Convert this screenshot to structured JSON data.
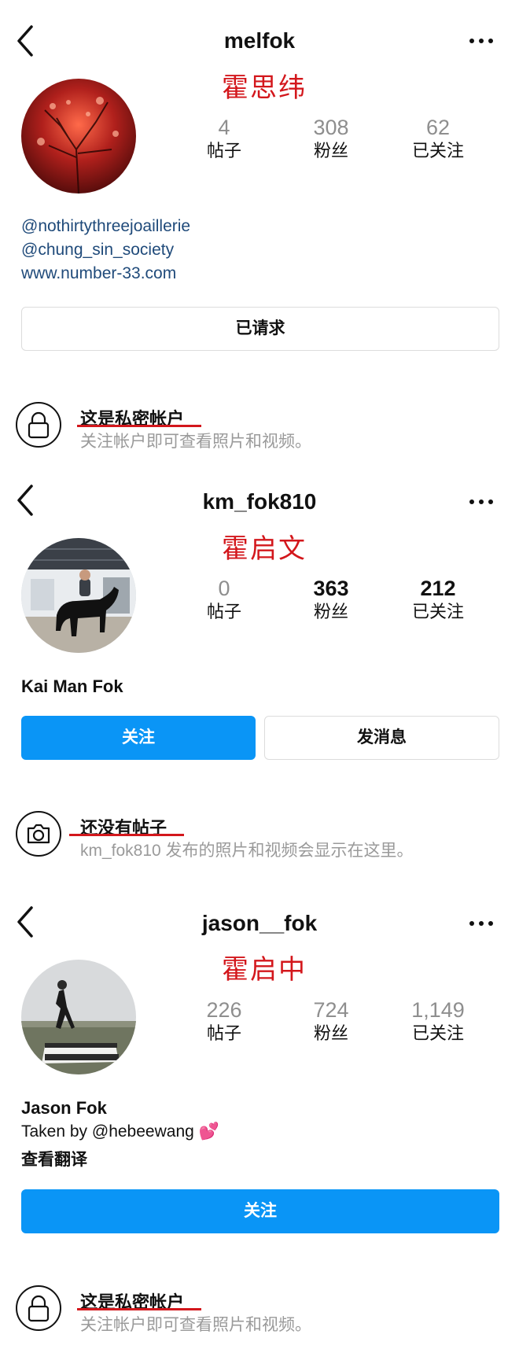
{
  "profiles": [
    {
      "username": "melfok",
      "cn_name": "霍思纬",
      "stats": [
        {
          "value": "4",
          "label": "帖子"
        },
        {
          "value": "308",
          "label": "粉丝"
        },
        {
          "value": "62",
          "label": "已关注"
        }
      ],
      "bio_links": [
        "@nothirtythreejoaillerie",
        "@chung_sin_society",
        "www.number-33.com"
      ],
      "button": "已请求",
      "info_title": "这是私密帐户",
      "info_sub": "关注帐户即可查看照片和视频。"
    },
    {
      "username": "km_fok810",
      "cn_name": "霍启文",
      "stats": [
        {
          "value": "0",
          "label": "帖子"
        },
        {
          "value": "363",
          "label": "粉丝"
        },
        {
          "value": "212",
          "label": "已关注"
        }
      ],
      "display_name": "Kai Man Fok",
      "follow_button": "关注",
      "message_button": "发消息",
      "info_title": "还没有帖子",
      "info_sub": "km_fok810 发布的照片和视频会显示在这里。"
    },
    {
      "username": "jason__fok",
      "cn_name": "霍启中",
      "stats": [
        {
          "value": "226",
          "label": "帖子"
        },
        {
          "value": "724",
          "label": "粉丝"
        },
        {
          "value": "1,149",
          "label": "已关注"
        }
      ],
      "display_name": "Jason Fok",
      "bio": "Taken by @hebeewang 💕",
      "translate": "查看翻译",
      "follow_button": "关注",
      "info_title": "这是私密帐户",
      "info_sub": "关注帐户即可查看照片和视频。"
    }
  ],
  "icons": [
    "back-chevron-icon",
    "more-dots-icon",
    "lock-icon",
    "camera-icon"
  ],
  "colors": {
    "accent_blue": "#0a95f6",
    "annotation_red": "#d3171c",
    "link_blue": "#1f4a7a"
  }
}
